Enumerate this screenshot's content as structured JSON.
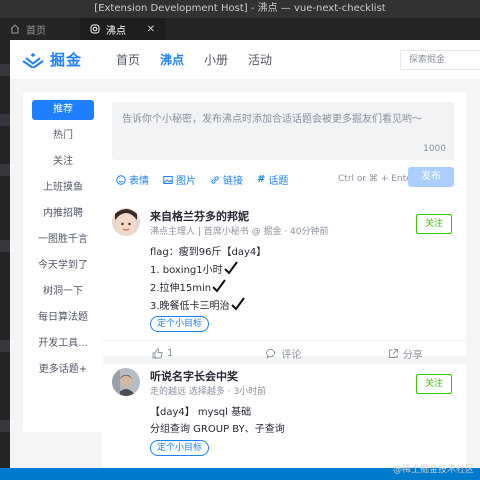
{
  "window": {
    "title": "[Extension Development Host] - 沸点 — vue-next-checklist"
  },
  "tabs": [
    {
      "label": "首页",
      "icon": "home-icon"
    },
    {
      "label": "沸点",
      "icon": "instagram-icon"
    }
  ],
  "nav": {
    "logo_text": "掘金",
    "links": [
      "首页",
      "沸点",
      "小册",
      "活动"
    ],
    "search_placeholder": "探索掘金"
  },
  "sidebar": {
    "items": [
      "推荐",
      "热门",
      "关注",
      "上班摸鱼",
      "内推招聘",
      "一图胜千言",
      "今天学到了",
      "树洞一下",
      "每日算法题",
      "开发工具...",
      "更多话题+"
    ]
  },
  "composer": {
    "placeholder": "告诉你个小秘密，发布沸点时添加合适话题会被更多掘友们看见哟～",
    "count": "1000",
    "tools": [
      "表情",
      "图片",
      "链接",
      "话题"
    ],
    "shortcut": "Ctrl or ⌘ + Enter",
    "publish": "发布"
  },
  "posts": [
    {
      "author": "来自格兰芬多的邦妮",
      "meta": "沸点主理人 | 首席小秘书 @ 掘金 · 40分钟前",
      "follow": "关注",
      "lines": [
        "flag：瘦到96斤【day4】",
        "1. boxing1小时",
        "2.拉伸15min",
        "3.晚餐低卡三明治"
      ],
      "tag": "定个小目标",
      "actions": {
        "like": "1",
        "comment": "评论",
        "share": "分享"
      }
    },
    {
      "author": "听说名字长会中奖",
      "meta": "走的越远 选择越多 · 3小时前",
      "follow": "关注",
      "lines": [
        "【day4】 mysql 基础",
        "分组查询 GROUP BY、子查询"
      ],
      "tag": "定个小目标"
    }
  ],
  "watermark": "@稀土掘金技术社区",
  "colors": {
    "accent": "#1e80ff",
    "follow": "#37c700",
    "statusbar": "#007acc"
  }
}
